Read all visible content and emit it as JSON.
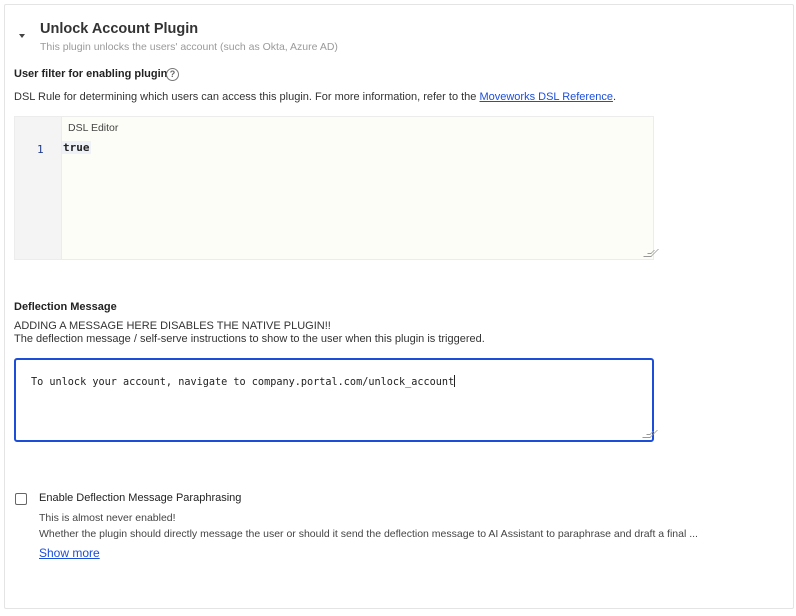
{
  "plugin": {
    "title": "Unlock Account Plugin",
    "subtitle": "This plugin unlocks the users' account (such as Okta, Azure AD)"
  },
  "user_filter": {
    "label": "User filter for enabling plugin",
    "help_icon": "question-circle-icon",
    "description_prefix": "DSL Rule for determining which users can access this plugin. For more information, refer to the ",
    "link_text": "Moveworks DSL Reference",
    "description_suffix": ".",
    "editor": {
      "label": "DSL Editor",
      "line_number": "1",
      "code": "true"
    }
  },
  "deflection": {
    "label": "Deflection Message",
    "warning": "ADDING A MESSAGE HERE DISABLES THE NATIVE PLUGIN!!",
    "description": "The deflection message / self-serve instructions to show to the user when this plugin is triggered.",
    "value": "To unlock your account, navigate to company.portal.com/unlock_account"
  },
  "paraphrasing": {
    "label": "Enable Deflection Message Paraphrasing",
    "checked": false,
    "note": "This is almost never enabled!",
    "description": "Whether the plugin should directly message the user or should it send the deflection message to AI Assistant to paraphrase and draft a final ...",
    "show_more": "Show more"
  },
  "colors": {
    "accent": "#1d4ed8",
    "muted_text": "#9a9a9a"
  }
}
